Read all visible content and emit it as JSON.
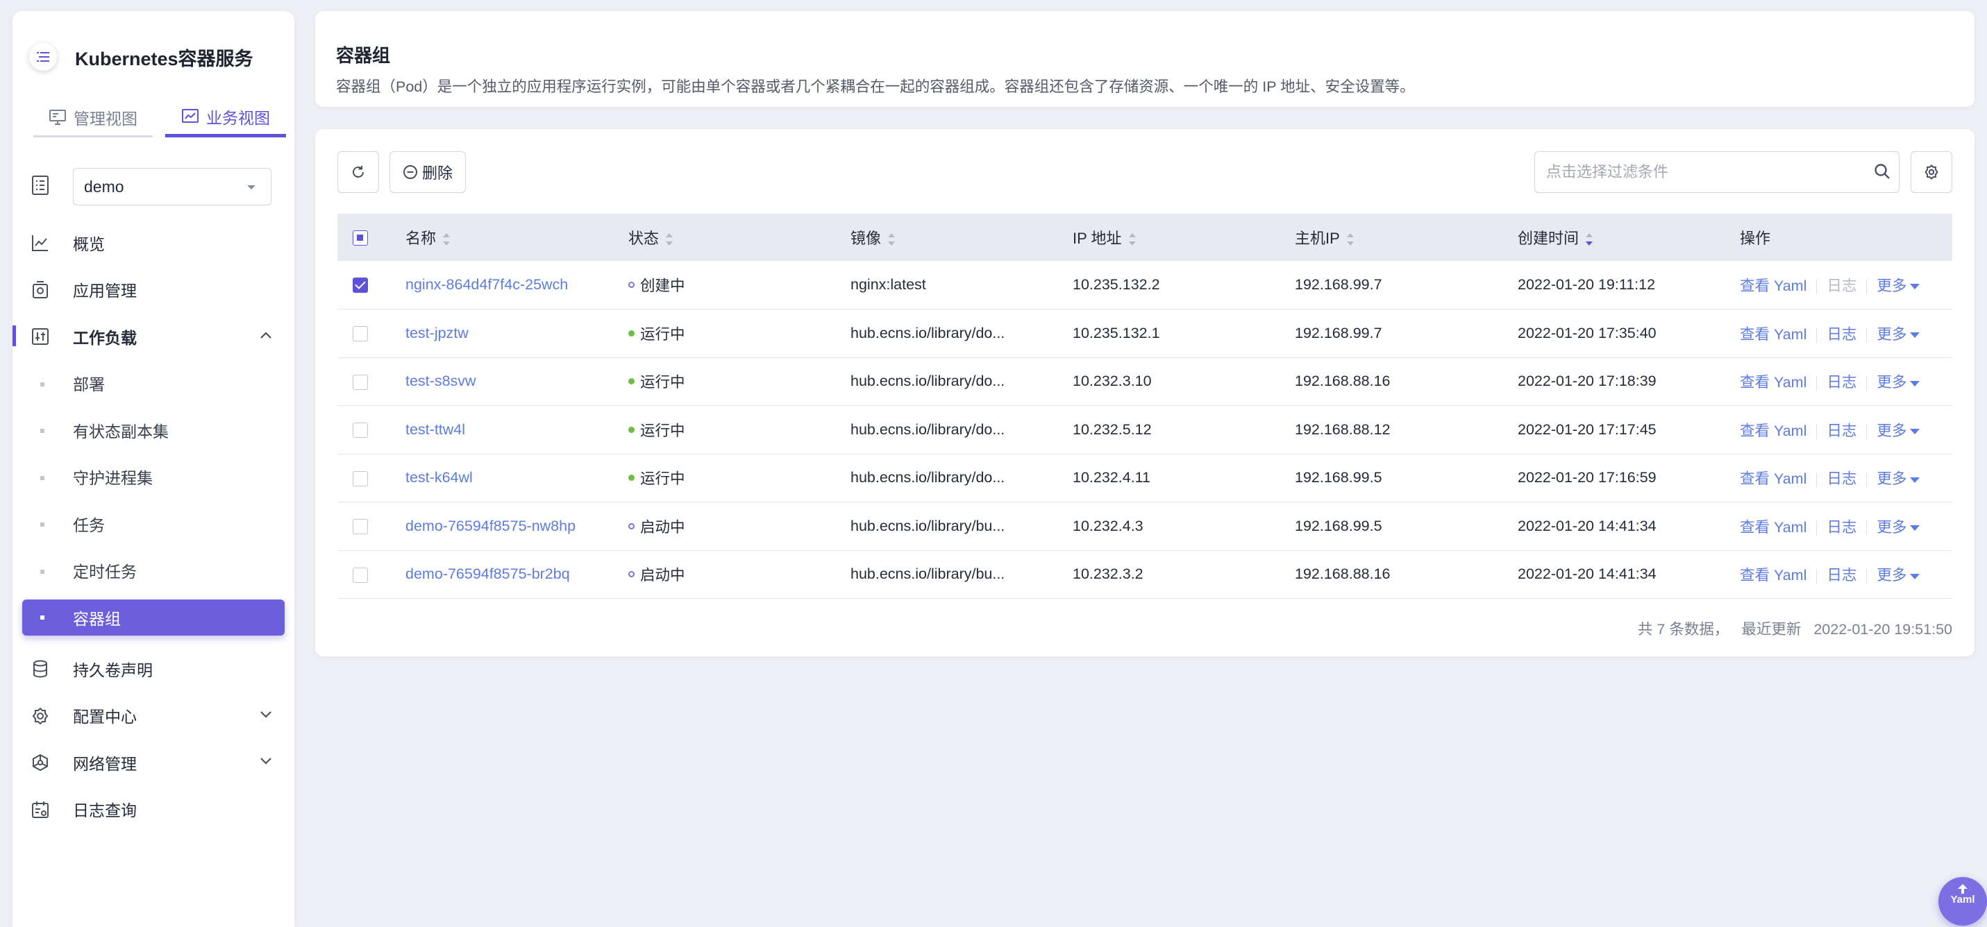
{
  "app": {
    "title": "Kubernetes容器服务",
    "view_tabs": [
      {
        "label": "管理视图",
        "active": false
      },
      {
        "label": "业务视图",
        "active": true
      }
    ]
  },
  "namespace": {
    "selected": "demo"
  },
  "nav": {
    "overview": "概览",
    "app_mgmt": "应用管理",
    "workload": "工作负载",
    "workload_items": [
      "部署",
      "有状态副本集",
      "守护进程集",
      "任务",
      "定时任务",
      "容器组"
    ],
    "active_item": "容器组",
    "pvc": "持久卷声明",
    "config_center": "配置中心",
    "network": "网络管理",
    "logs": "日志查询"
  },
  "header": {
    "title": "容器组",
    "description": "容器组（Pod）是一个独立的应用程序运行实例，可能由单个容器或者几个紧耦合在一起的容器组成。容器组还包含了存储资源、一个唯一的 IP 地址、安全设置等。"
  },
  "toolbar": {
    "delete_label": "删除",
    "filter_placeholder": "点击选择过滤条件"
  },
  "table": {
    "columns": [
      "名称",
      "状态",
      "镜像",
      "IP 地址",
      "主机IP",
      "创建时间",
      "操作"
    ],
    "rows": [
      {
        "name": "nginx-864d4f7f4c-25wch",
        "status": "创建中",
        "status_type": "pending",
        "image": "nginx:latest",
        "ip": "10.235.132.2",
        "host_ip": "192.168.99.7",
        "created": "2022-01-20 19:11:12",
        "checked": true,
        "log_disabled": true
      },
      {
        "name": "test-jpztw",
        "status": "运行中",
        "status_type": "running",
        "image": "hub.ecns.io/library/do...",
        "ip": "10.235.132.1",
        "host_ip": "192.168.99.7",
        "created": "2022-01-20 17:35:40",
        "checked": false,
        "log_disabled": false
      },
      {
        "name": "test-s8svw",
        "status": "运行中",
        "status_type": "running",
        "image": "hub.ecns.io/library/do...",
        "ip": "10.232.3.10",
        "host_ip": "192.168.88.16",
        "created": "2022-01-20 17:18:39",
        "checked": false,
        "log_disabled": false
      },
      {
        "name": "test-ttw4l",
        "status": "运行中",
        "status_type": "running",
        "image": "hub.ecns.io/library/do...",
        "ip": "10.232.5.12",
        "host_ip": "192.168.88.12",
        "created": "2022-01-20 17:17:45",
        "checked": false,
        "log_disabled": false
      },
      {
        "name": "test-k64wl",
        "status": "运行中",
        "status_type": "running",
        "image": "hub.ecns.io/library/do...",
        "ip": "10.232.4.11",
        "host_ip": "192.168.99.5",
        "created": "2022-01-20 17:16:59",
        "checked": false,
        "log_disabled": false
      },
      {
        "name": "demo-76594f8575-nw8hp",
        "status": "启动中",
        "status_type": "pending",
        "image": "hub.ecns.io/library/bu...",
        "ip": "10.232.4.3",
        "host_ip": "192.168.99.5",
        "created": "2022-01-20 14:41:34",
        "checked": false,
        "log_disabled": false
      },
      {
        "name": "demo-76594f8575-br2bq",
        "status": "启动中",
        "status_type": "pending",
        "image": "hub.ecns.io/library/bu...",
        "ip": "10.232.3.2",
        "host_ip": "192.168.88.16",
        "created": "2022-01-20 14:41:34",
        "checked": false,
        "log_disabled": false
      }
    ],
    "ops": {
      "view_yaml": "查看 Yaml",
      "log": "日志",
      "more": "更多"
    }
  },
  "footer": {
    "total": "共 7 条数据，",
    "last_update_label": "最近更新",
    "last_update": "2022-01-20 19:51:50"
  },
  "fab": {
    "label": "Yaml"
  },
  "colors": {
    "accent": "#5e52d6",
    "link": "#5e7ce0",
    "running": "#6cbf43"
  }
}
